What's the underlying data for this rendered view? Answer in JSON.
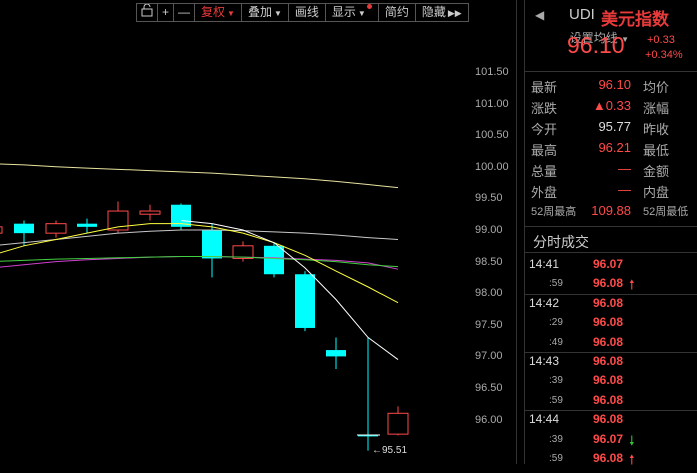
{
  "toolbar": {
    "lock_label": "",
    "plus_label": "+",
    "minus_label": "—",
    "fuquan_label": "复权",
    "diejia_label": "叠加",
    "huaxian_label": "画线",
    "xianshi_label": "显示",
    "jianyue_label": "简约",
    "yincang_label": "隐藏"
  },
  "ma_settings": "设置均线",
  "y_axis_labels": [
    "101.50",
    "101.00",
    "100.50",
    "100.00",
    "99.50",
    "99.00",
    "98.50",
    "98.00",
    "97.50",
    "97.00",
    "96.50",
    "96.00"
  ],
  "low_annotation": "95.51",
  "chart_data": {
    "type": "candlestick",
    "ylim": [
      95.4,
      101.6
    ],
    "candles": [
      {
        "o": 98.95,
        "c": 99.05,
        "h": 99.15,
        "l": 98.85,
        "color": "red"
      },
      {
        "o": 99.1,
        "c": 98.95,
        "h": 99.15,
        "l": 98.75,
        "color": "cyan"
      },
      {
        "o": 98.95,
        "c": 99.1,
        "h": 99.15,
        "l": 98.88,
        "color": "red"
      },
      {
        "o": 99.05,
        "c": 99.1,
        "h": 99.18,
        "l": 98.95,
        "color": "cyan"
      },
      {
        "o": 99.0,
        "c": 99.3,
        "h": 99.45,
        "l": 98.95,
        "color": "red"
      },
      {
        "o": 99.25,
        "c": 99.3,
        "h": 99.4,
        "l": 99.15,
        "color": "red"
      },
      {
        "o": 99.4,
        "c": 99.05,
        "h": 99.42,
        "l": 99.0,
        "color": "cyan"
      },
      {
        "o": 99.0,
        "c": 98.55,
        "h": 99.1,
        "l": 98.25,
        "color": "cyan"
      },
      {
        "o": 98.55,
        "c": 98.75,
        "h": 98.82,
        "l": 98.5,
        "color": "red"
      },
      {
        "o": 98.75,
        "c": 98.3,
        "h": 98.8,
        "l": 98.25,
        "color": "cyan"
      },
      {
        "o": 98.3,
        "c": 97.45,
        "h": 98.35,
        "l": 97.4,
        "color": "cyan"
      },
      {
        "o": 97.1,
        "c": 97.0,
        "h": 97.3,
        "l": 96.8,
        "color": "cyan"
      },
      {
        "o": 95.75,
        "c": 95.75,
        "h": 97.3,
        "l": 95.51,
        "color": "cyan"
      },
      {
        "o": 95.77,
        "c": 96.1,
        "h": 96.21,
        "l": 95.75,
        "color": "red"
      }
    ],
    "moving_averages": [
      {
        "color": "#e8e3a0",
        "points": [
          100.05,
          100.03,
          100.0,
          99.98,
          99.96,
          99.94,
          99.92,
          99.9,
          99.87,
          99.84,
          99.81,
          99.77,
          99.72,
          99.67
        ]
      },
      {
        "color": "#c8c8c8",
        "points": [
          98.75,
          98.8,
          98.85,
          98.9,
          98.95,
          98.98,
          99.0,
          99.0,
          98.99,
          98.97,
          98.95,
          98.92,
          98.88,
          98.85
        ]
      },
      {
        "color": "#d040d0",
        "points": [
          98.4,
          98.45,
          98.5,
          98.53,
          98.55,
          98.57,
          98.58,
          98.58,
          98.57,
          98.56,
          98.54,
          98.52,
          98.48,
          98.38
        ]
      },
      {
        "color": "#40d040",
        "points": [
          98.5,
          98.52,
          98.54,
          98.55,
          98.56,
          98.57,
          98.58,
          98.58,
          98.57,
          98.55,
          98.53,
          98.5,
          98.45,
          98.42
        ]
      },
      {
        "color": "#ffff40",
        "points": [
          98.6,
          98.75,
          98.85,
          98.95,
          99.05,
          99.1,
          99.1,
          99.05,
          98.95,
          98.8,
          98.6,
          98.35,
          98.1,
          97.85
        ]
      },
      {
        "color": "#ffffff",
        "points": [
          null,
          null,
          null,
          null,
          null,
          null,
          99.15,
          99.1,
          99.0,
          98.8,
          98.4,
          97.9,
          97.3,
          96.95
        ]
      }
    ]
  },
  "quote": {
    "code": "UDI",
    "name": "美元指数",
    "price": "96.10",
    "change": "+0.33",
    "change_pct": "+0.34%",
    "rows": [
      {
        "l1": "最新",
        "v1": "96.10",
        "l2": "均价"
      },
      {
        "l1": "涨跌",
        "v1": "▲0.33",
        "l2": "涨幅"
      },
      {
        "l1": "今开",
        "v1": "95.77",
        "l2": "昨收"
      },
      {
        "l1": "最高",
        "v1": "96.21",
        "l2": "最低"
      },
      {
        "l1": "总量",
        "v1": "—",
        "l2": "金额"
      },
      {
        "l1": "外盘",
        "v1": "—",
        "l2": "内盘"
      },
      {
        "l1": "52周最高",
        "v1": "109.88",
        "l2": "52周最低"
      }
    ]
  },
  "ticks_title": "分时成交",
  "ticks": [
    {
      "time": "14:41",
      "sec": "",
      "price": "96.07",
      "arrow": ""
    },
    {
      "time": "",
      "sec": ":59",
      "price": "96.08",
      "arrow": "up"
    },
    {
      "time": "14:42",
      "sec": "",
      "price": "96.08",
      "arrow": ""
    },
    {
      "time": "",
      "sec": ":29",
      "price": "96.08",
      "arrow": ""
    },
    {
      "time": "",
      "sec": ":49",
      "price": "96.08",
      "arrow": ""
    },
    {
      "time": "14:43",
      "sec": "",
      "price": "96.08",
      "arrow": ""
    },
    {
      "time": "",
      "sec": ":39",
      "price": "96.08",
      "arrow": ""
    },
    {
      "time": "",
      "sec": ":59",
      "price": "96.08",
      "arrow": ""
    },
    {
      "time": "14:44",
      "sec": "",
      "price": "96.08",
      "arrow": ""
    },
    {
      "time": "",
      "sec": ":39",
      "price": "96.07",
      "arrow": "down"
    },
    {
      "time": "",
      "sec": ":59",
      "price": "96.08",
      "arrow": "up"
    }
  ],
  "colors": {
    "up": "#ff4a4a",
    "down": "#00ffff",
    "name": "#e83a3a",
    "arrow_up": "#ff4a4a",
    "arrow_down": "#2fc42f"
  }
}
